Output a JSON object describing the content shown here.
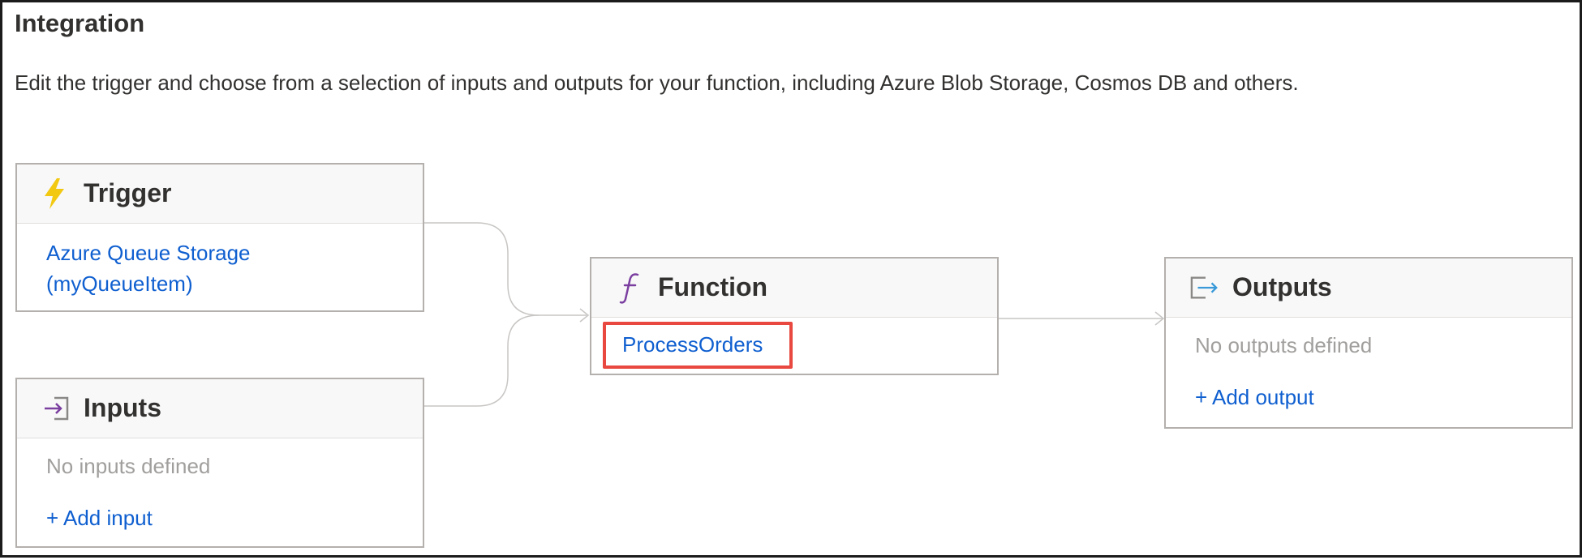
{
  "page": {
    "title": "Integration",
    "description": "Edit the trigger and choose from a selection of inputs and outputs for your function, including Azure Blob Storage, Cosmos DB and others."
  },
  "trigger": {
    "title": "Trigger",
    "icon": "lightning-bolt-icon",
    "binding_line1": "Azure Queue Storage",
    "binding_line2": "(myQueueItem)"
  },
  "inputs": {
    "title": "Inputs",
    "icon": "input-arrow-icon",
    "empty_text": "No inputs defined",
    "add_label": "+ Add input"
  },
  "function": {
    "title": "Function",
    "icon": "function-f-icon",
    "name": "ProcessOrders",
    "highlight_color": "#e8483f"
  },
  "outputs": {
    "title": "Outputs",
    "icon": "output-arrow-icon",
    "empty_text": "No outputs defined",
    "add_label": "+ Add output"
  },
  "colors": {
    "link": "#0f5fd0",
    "muted": "#a19f9d",
    "trigger_icon": "#f2c811",
    "function_icon": "#7b3fa0",
    "outputs_icon_arrow": "#3a9ad9"
  }
}
